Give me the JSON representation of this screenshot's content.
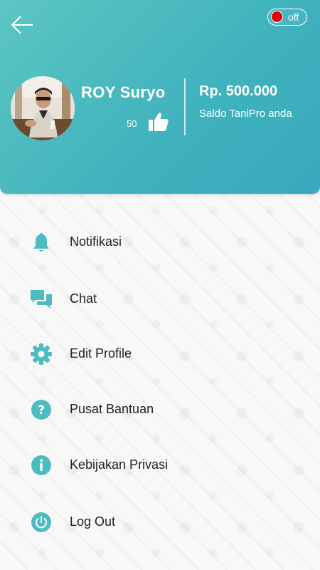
{
  "colors": {
    "accent": "#4dbcc0",
    "header_start": "#5cc6c2",
    "header_end": "#38a9bd",
    "toggle_dot": "#e00000",
    "text_dark": "#1f1f1f"
  },
  "header": {
    "back_icon": "arrow-left-icon",
    "toggle": {
      "label": "off",
      "state": "off"
    },
    "profile": {
      "name": "ROY Suryo",
      "likes": "50",
      "like_icon": "thumbs-up-icon"
    },
    "balance": {
      "amount": "Rp. 500.000",
      "caption": "Saldo TaniPro anda"
    }
  },
  "menu": {
    "items": [
      {
        "label": "Notifikasi",
        "icon": "bell-icon"
      },
      {
        "label": "Chat",
        "icon": "chat-bubbles-icon"
      },
      {
        "label": "Edit Profile",
        "icon": "gear-icon"
      },
      {
        "label": "Pusat Bantuan",
        "icon": "help-circle-icon"
      },
      {
        "label": "Kebijakan Privasi",
        "icon": "info-circle-icon"
      },
      {
        "label": "Log Out",
        "icon": "power-icon"
      }
    ]
  }
}
